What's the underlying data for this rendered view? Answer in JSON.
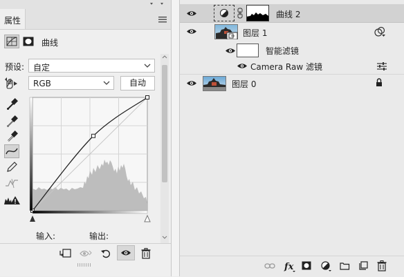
{
  "properties_panel": {
    "tab_label": "属性",
    "adjustment_name": "曲线",
    "preset_label": "预设:",
    "preset_value": "自定",
    "channel_value": "RGB",
    "auto_button": "自动",
    "input_label": "输入:",
    "output_label": "输出:"
  },
  "curve": {
    "control_points": [
      {
        "input": 0,
        "output": 0
      },
      {
        "input": 0.53,
        "output": 0.66
      },
      {
        "input": 1,
        "output": 1
      }
    ]
  },
  "layers_panel": {
    "layers": [
      {
        "name": "曲线 2",
        "type": "adjustment-curves",
        "visible": true,
        "selected": true
      },
      {
        "name": "图层 1",
        "type": "smart-object",
        "visible": true
      },
      {
        "name": "智能滤镜",
        "type": "smart-filters",
        "visible": true
      },
      {
        "name": "Camera Raw 滤镜",
        "type": "filter",
        "visible": true
      },
      {
        "name": "图层 0",
        "type": "pixel",
        "visible": true,
        "locked": true
      }
    ],
    "bottom_tools": [
      "link-icon",
      "fx-icon",
      "mask-icon",
      "adjustment-icon",
      "group-folder-icon",
      "new-layer-icon",
      "trash-icon"
    ]
  },
  "colors": {
    "panel_bg": "#efefef",
    "selected_layer": "#d2d2d2",
    "curve": "#222222",
    "histogram": "#bdbdbd"
  }
}
